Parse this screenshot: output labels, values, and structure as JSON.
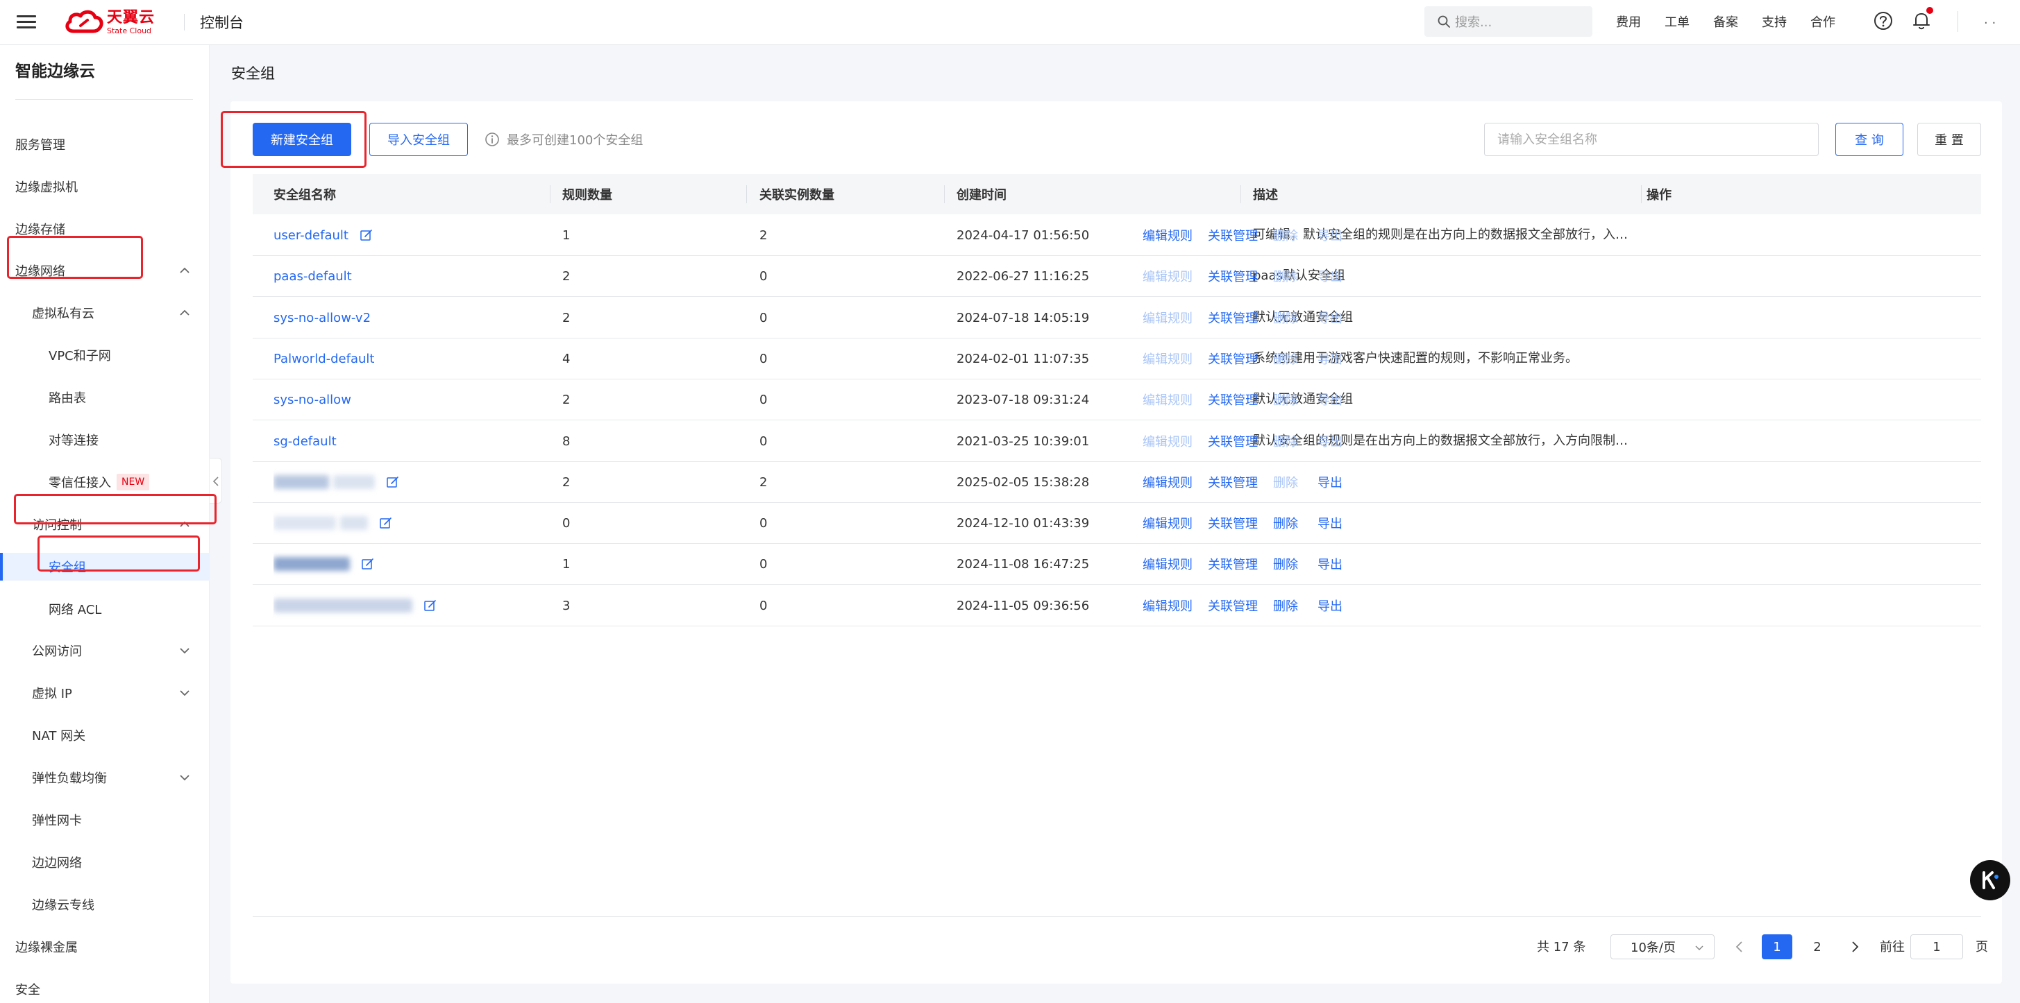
{
  "topbar": {
    "logo_cn": "天翼云",
    "logo_en": "State Cloud",
    "console": "控制台",
    "search_placeholder": "搜索...",
    "links": [
      "费用",
      "工单",
      "备案",
      "支持",
      "合作"
    ],
    "user": ". ."
  },
  "sidebar": {
    "title": "智能边缘云",
    "items": [
      {
        "label": "服务管理"
      },
      {
        "label": "边缘虚拟机"
      },
      {
        "label": "边缘存储"
      },
      {
        "label": "边缘网络"
      },
      {
        "label": "虚拟私有云"
      },
      {
        "label": "VPC和子网"
      },
      {
        "label": "路由表"
      },
      {
        "label": "对等连接"
      },
      {
        "label": "零信任接入",
        "badge": "NEW"
      },
      {
        "label": "访问控制"
      },
      {
        "label": "安全组"
      },
      {
        "label": "网络 ACL"
      },
      {
        "label": "公网访问"
      },
      {
        "label": "虚拟 IP"
      },
      {
        "label": "NAT 网关"
      },
      {
        "label": "弹性负载均衡"
      },
      {
        "label": "弹性网卡"
      },
      {
        "label": "边边网络"
      },
      {
        "label": "边缘云专线"
      },
      {
        "label": "边缘裸金属"
      },
      {
        "label": "安全"
      }
    ]
  },
  "page": {
    "title": "安全组",
    "create_button": "新建安全组",
    "import_button": "导入安全组",
    "tip": "最多可创建100个安全组",
    "search_placeholder": "请输入安全组名称",
    "query_button": "查 询",
    "reset_button": "重 置"
  },
  "table": {
    "columns": [
      "安全组名称",
      "规则数量",
      "关联实例数量",
      "创建时间",
      "描述",
      "操作"
    ],
    "ops": [
      "编辑规则",
      "关联管理",
      "删除",
      "导出"
    ],
    "rows": [
      {
        "name": "user-default",
        "editable": true,
        "rules": "1",
        "instances": "2",
        "created": "2024-04-17 01:56:50",
        "desc": "可编辑，默认安全组的规则是在出方向上的数据报文全部放行，入方向限制所有访问",
        "ops_enabled": [
          true,
          true,
          false,
          false
        ]
      },
      {
        "name": "paas-default",
        "editable": false,
        "rules": "2",
        "instances": "0",
        "created": "2022-06-27 11:16:25",
        "desc": "paas默认安全组",
        "ops_enabled": [
          false,
          true,
          false,
          false
        ]
      },
      {
        "name": "sys-no-allow-v2",
        "editable": false,
        "rules": "2",
        "instances": "0",
        "created": "2024-07-18 14:05:19",
        "desc": "默认无放通安全组",
        "ops_enabled": [
          false,
          true,
          false,
          false
        ]
      },
      {
        "name": "Palworld-default",
        "editable": false,
        "rules": "4",
        "instances": "0",
        "created": "2024-02-01 11:07:35",
        "desc": "系统创建用于游戏客户快速配置的规则，不影响正常业务。",
        "ops_enabled": [
          false,
          true,
          false,
          false
        ]
      },
      {
        "name": "sys-no-allow",
        "editable": false,
        "rules": "2",
        "instances": "0",
        "created": "2023-07-18 09:31:24",
        "desc": "默认无放通安全组",
        "ops_enabled": [
          false,
          true,
          false,
          false
        ]
      },
      {
        "name": "sg-default",
        "editable": false,
        "rules": "8",
        "instances": "0",
        "created": "2021-03-25 10:39:01",
        "desc": "默认安全组的规则是在出方向上的数据报文全部放行，入方向限制所有访问",
        "ops_enabled": [
          false,
          true,
          false,
          false
        ]
      },
      {
        "name": "",
        "blurred": true,
        "editable": true,
        "rules": "2",
        "instances": "2",
        "created": "2025-02-05 15:38:28",
        "desc": "",
        "ops_enabled": [
          true,
          true,
          false,
          true
        ]
      },
      {
        "name": "",
        "blurred": true,
        "editable": true,
        "rules": "0",
        "instances": "0",
        "created": "2024-12-10 01:43:39",
        "desc": "",
        "ops_enabled": [
          true,
          true,
          true,
          true
        ]
      },
      {
        "name": "",
        "blurred": true,
        "editable": true,
        "rules": "1",
        "instances": "0",
        "created": "2024-11-08 16:47:25",
        "desc": "",
        "ops_enabled": [
          true,
          true,
          true,
          true
        ]
      },
      {
        "name": "",
        "blurred": true,
        "editable": true,
        "rules": "3",
        "instances": "0",
        "created": "2024-11-05 09:36:56",
        "desc": "",
        "ops_enabled": [
          true,
          true,
          true,
          true
        ]
      }
    ]
  },
  "pagination": {
    "total": "共 17 条",
    "page_size": "10条/页",
    "pages": [
      "1",
      "2"
    ],
    "current": "1",
    "goto_label": "前往",
    "goto_value": "1",
    "page_suffix": "页"
  },
  "colors": {
    "primary": "#2468f2",
    "disabled_link": "#a9c5f7",
    "brand_red": "#e60012",
    "annotation_red": "#e8242c"
  }
}
